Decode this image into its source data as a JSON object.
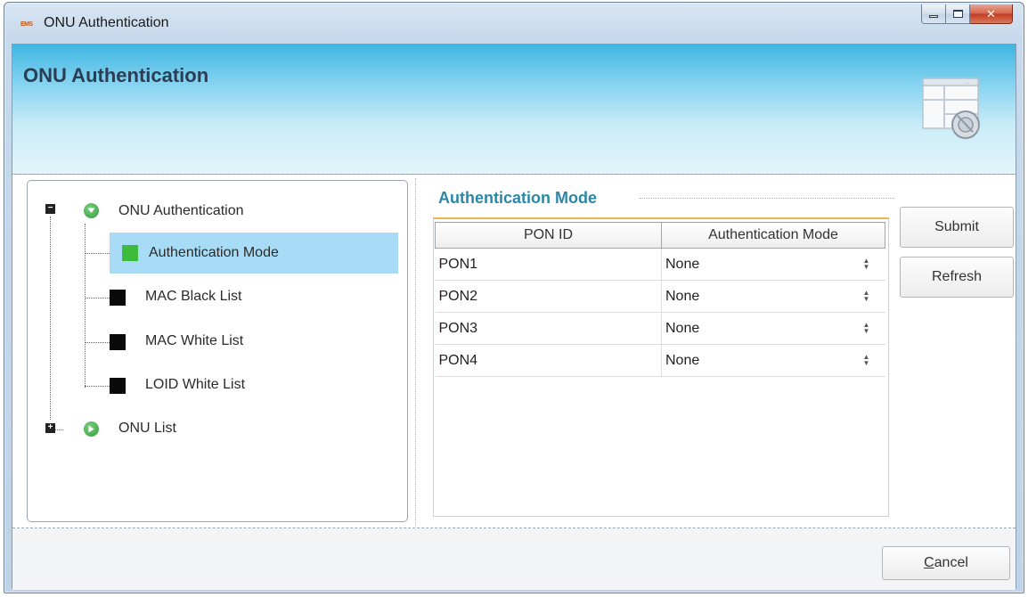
{
  "window": {
    "icon_text": "EMS",
    "title": "ONU Authentication"
  },
  "banner": {
    "title": "ONU Authentication"
  },
  "tree": {
    "root": {
      "label": "ONU Authentication",
      "expander": "−"
    },
    "children": [
      {
        "label": "Authentication Mode",
        "selected": true,
        "color": "#3dbb3d"
      },
      {
        "label": "MAC Black List",
        "color": "#0a0a0a"
      },
      {
        "label": "MAC White List",
        "color": "#0a0a0a"
      },
      {
        "label": "LOID White List",
        "color": "#0a0a0a"
      }
    ],
    "second_root": {
      "label": "ONU List",
      "expander": "+"
    }
  },
  "section": {
    "title": "Authentication Mode"
  },
  "table": {
    "columns": [
      "PON ID",
      "Authentication Mode"
    ],
    "rows": [
      {
        "pon": "PON1",
        "mode": "None"
      },
      {
        "pon": "PON2",
        "mode": "None"
      },
      {
        "pon": "PON3",
        "mode": "None"
      },
      {
        "pon": "PON4",
        "mode": "None"
      }
    ]
  },
  "buttons": {
    "submit": "Submit",
    "refresh": "Refresh",
    "cancel_first": "C",
    "cancel_rest": "ancel"
  },
  "colors": {
    "banner_top": "#3fb6e2",
    "section_title": "#2a87a9",
    "selection": "#a8dcf6",
    "table_accent": "#f0b34a"
  }
}
